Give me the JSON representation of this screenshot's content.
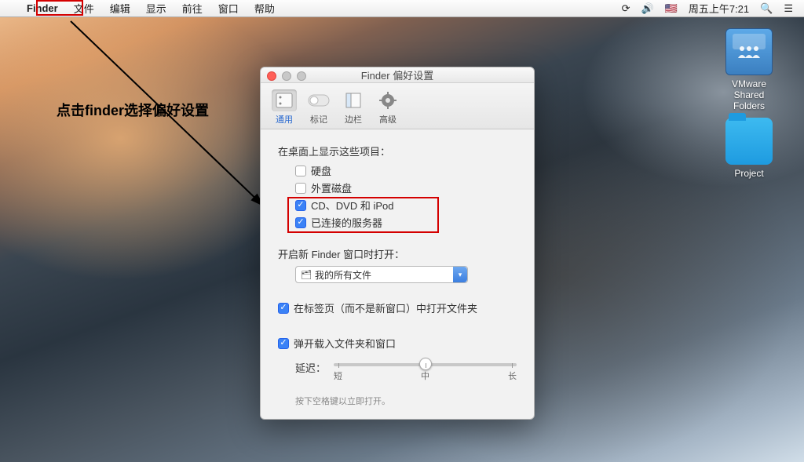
{
  "menubar": {
    "app": "Finder",
    "items": [
      "文件",
      "编辑",
      "显示",
      "前往",
      "窗口",
      "帮助"
    ],
    "clock": "周五上午7:21"
  },
  "annotation": {
    "text": "点击finder选择偏好设置"
  },
  "desktop": {
    "vmware_label": "VMware Shared Folders",
    "project_label": "Project"
  },
  "pref": {
    "title": "Finder 偏好设置",
    "tabs": {
      "general": "通用",
      "tags": "标记",
      "sidebar": "边栏",
      "advanced": "高级"
    },
    "show_on_desktop_label": "在桌面上显示这些项目：",
    "items": {
      "hdd": "硬盘",
      "external": "外置磁盘",
      "optical": "CD、DVD 和 iPod",
      "servers": "已连接的服务器"
    },
    "new_window_label": "开启新 Finder 窗口时打开：",
    "new_window_value": "我的所有文件",
    "open_in_tabs": "在标签页（而不是新窗口）中打开文件夹",
    "spring_loaded": "弹开载入文件夹和窗口",
    "delay_label": "延迟：",
    "ticks": {
      "short": "短",
      "mid": "中",
      "long": "长"
    },
    "hint": "按下空格键以立即打开。"
  }
}
